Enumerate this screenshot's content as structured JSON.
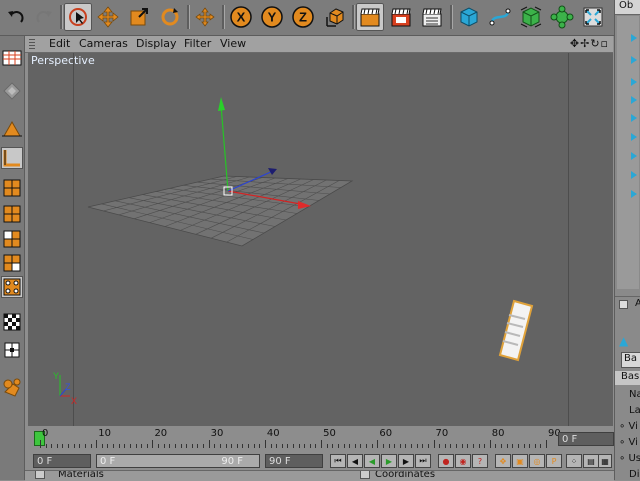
{
  "menu": [
    "Edit",
    "Cameras",
    "Display",
    "Filter",
    "View"
  ],
  "viewport": {
    "label": "Perspective"
  },
  "timeline": {
    "ticks": [
      "0",
      "10",
      "20",
      "30",
      "40",
      "50",
      "60",
      "70",
      "80",
      "90"
    ],
    "current_frame": "0 F"
  },
  "playback": {
    "start": "0 F",
    "range_start": "0 F",
    "range_end": "90 F",
    "end": "90 F"
  },
  "right_panel": {
    "tab": "Ob",
    "attr_a": "A",
    "basic_tab": "Ba",
    "basic_header": "Bas",
    "rows": [
      "Na",
      "La",
      "Vi",
      "Vi",
      "Us",
      "Di"
    ]
  },
  "bottom": {
    "materials": "Materials",
    "coordinates": "Coordinates"
  },
  "colors": {
    "accent": "#e28a1f",
    "viewport": "#636363",
    "panel": "#8e8e8e"
  }
}
